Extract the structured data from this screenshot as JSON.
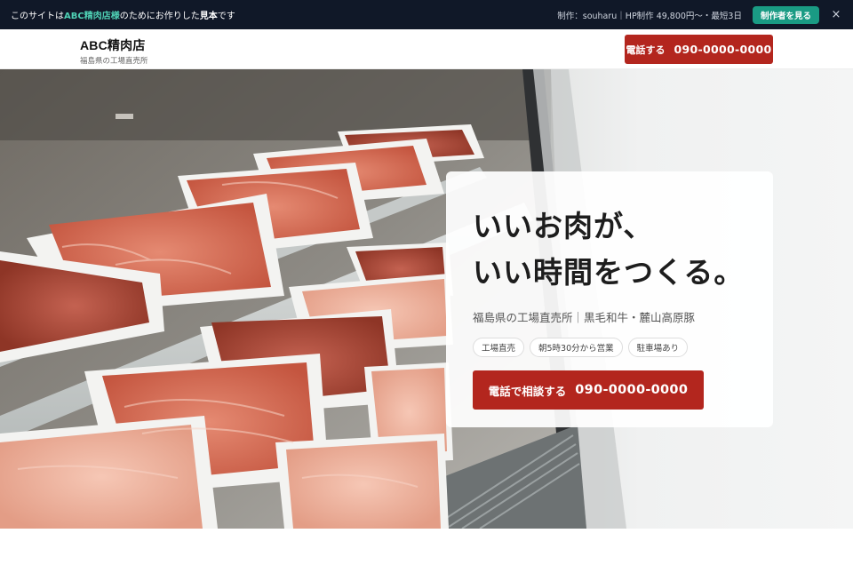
{
  "promo": {
    "prefix": "このサイトは ",
    "shop": "ABC精肉店様",
    "middle": " のためにお作りした",
    "sample": "見本",
    "suffix": "です",
    "credit": "制作：souharu｜HP制作 49,800円〜・最短3日",
    "maker_button": "制作者を見る",
    "close_icon": "×"
  },
  "header": {
    "shop_name": "ABC精肉店",
    "shop_sub": "福島県の工場直売所",
    "call_label": "電話する",
    "call_number": "090-0000-0000"
  },
  "hero": {
    "image": "meat-display-case-photo",
    "headline_line1": "いいお肉が、",
    "headline_line2": "いい時間をつくる。",
    "lead": "福島県の工場直売所｜黒毛和牛・麓山高原豚",
    "tags": [
      "工場直売",
      "朝5時30分から営業",
      "駐車場あり"
    ],
    "cta_label": "電話で相談する",
    "cta_number": "090-0000-0000"
  },
  "colors": {
    "promo_bg": "#101828",
    "accent_green": "#1a9b84",
    "accent_red": "#b3261e"
  }
}
